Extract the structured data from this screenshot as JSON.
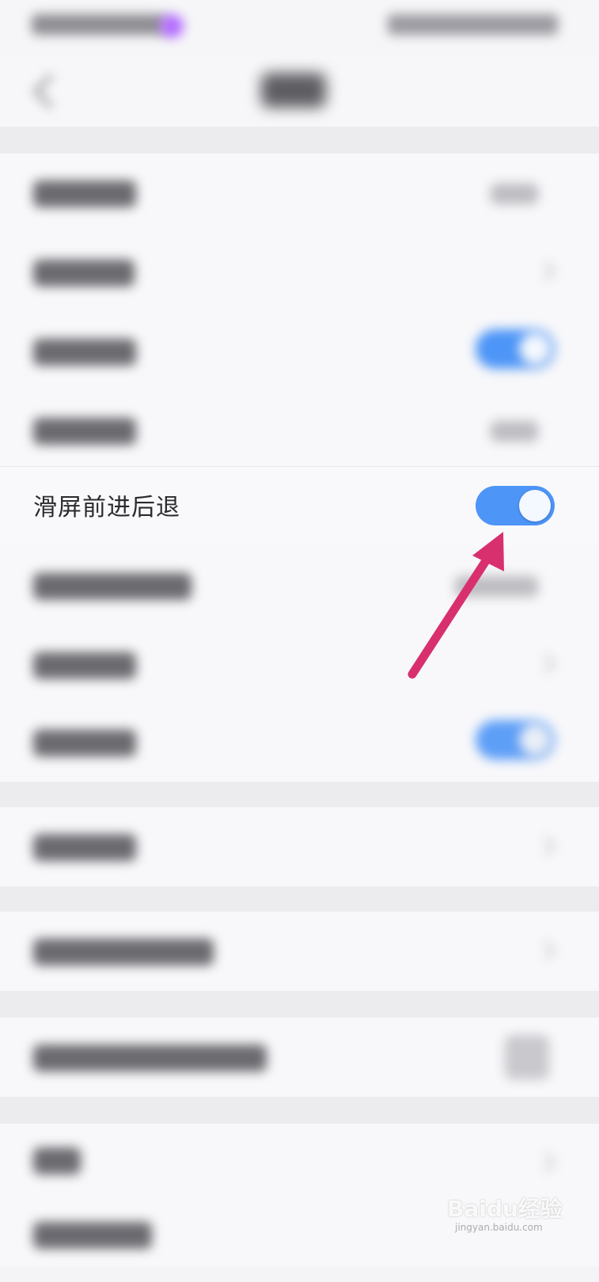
{
  "focused_setting": {
    "label": "滑屏前进后退",
    "enabled": true
  },
  "watermark": {
    "brand": "Baidu经验",
    "url": "jingyan.baidu.com"
  },
  "colors": {
    "toggle_on": "#4d95f7",
    "arrow": "#d8306f"
  },
  "icons": {
    "back": "back-icon",
    "chevron": "chevron-right-icon"
  }
}
